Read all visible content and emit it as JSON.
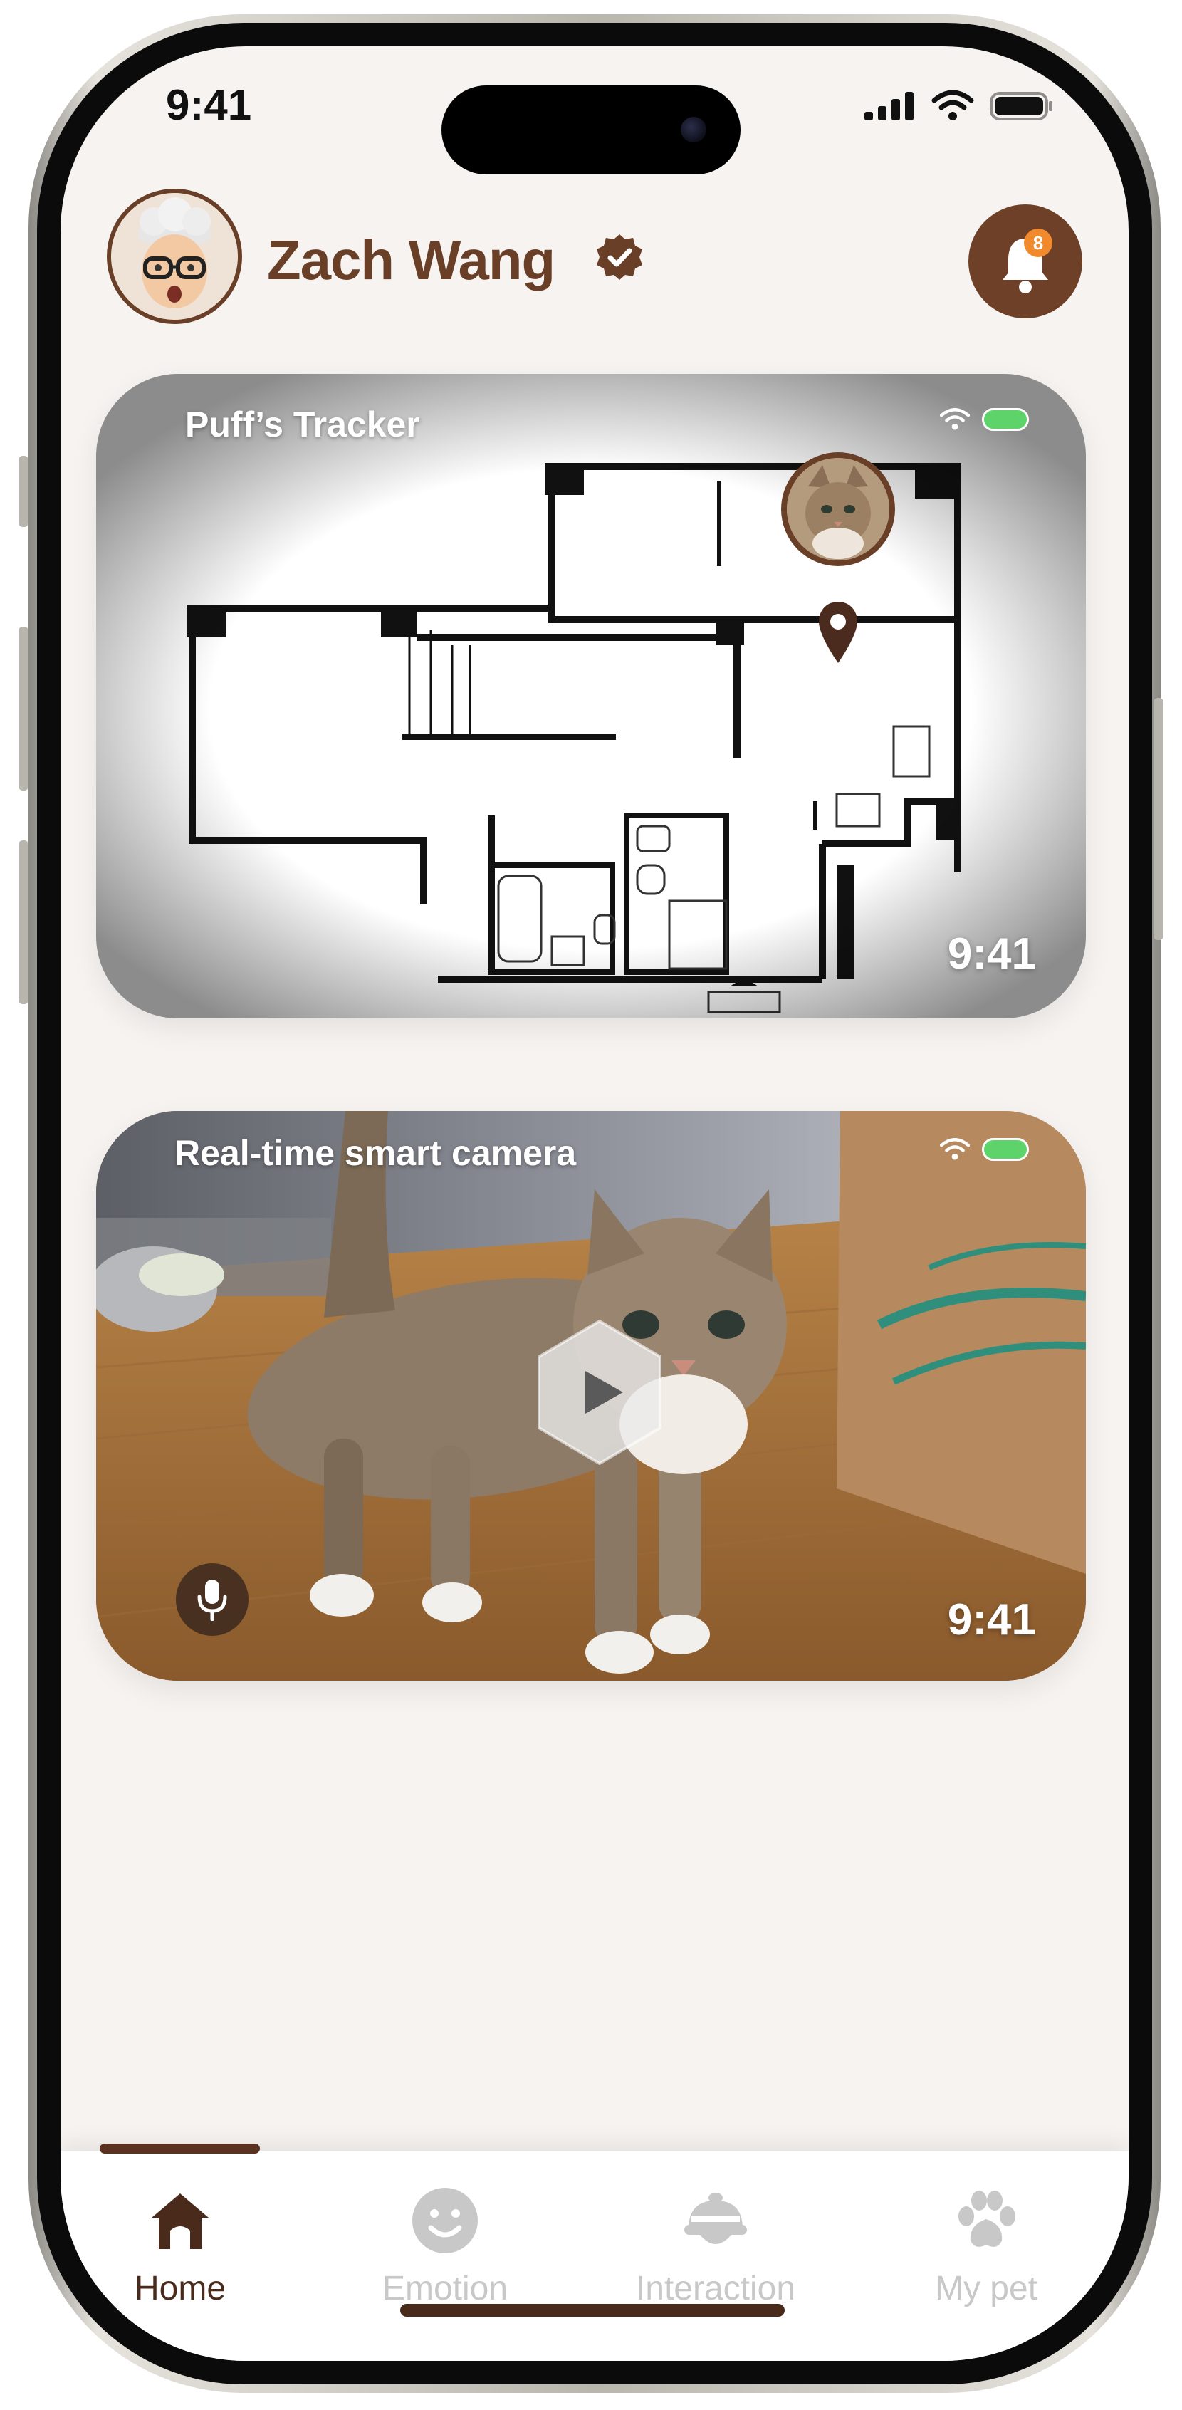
{
  "status_bar": {
    "time": "9:41"
  },
  "header": {
    "user_name": "Zach Wang",
    "notification_count": "8"
  },
  "tracker_card": {
    "title": "Puff’s Tracker",
    "time": "9:41"
  },
  "camera_card": {
    "title": "Real-time smart camera",
    "time": "9:41"
  },
  "tab_bar": {
    "tabs": [
      {
        "label": "Home",
        "icon": "house-icon",
        "active": true
      },
      {
        "label": "Emotion",
        "icon": "smiley-icon",
        "active": false
      },
      {
        "label": "Interaction",
        "icon": "bell-toy-icon",
        "active": false
      },
      {
        "label": "My pet",
        "icon": "paw-icon",
        "active": false
      }
    ]
  },
  "colors": {
    "brand_brown": "#6a3f28",
    "background": "#f7f3f0",
    "badge_orange": "#f08a2c",
    "battery_green": "#5dd36a",
    "inactive_tab": "#c8c8c8"
  }
}
